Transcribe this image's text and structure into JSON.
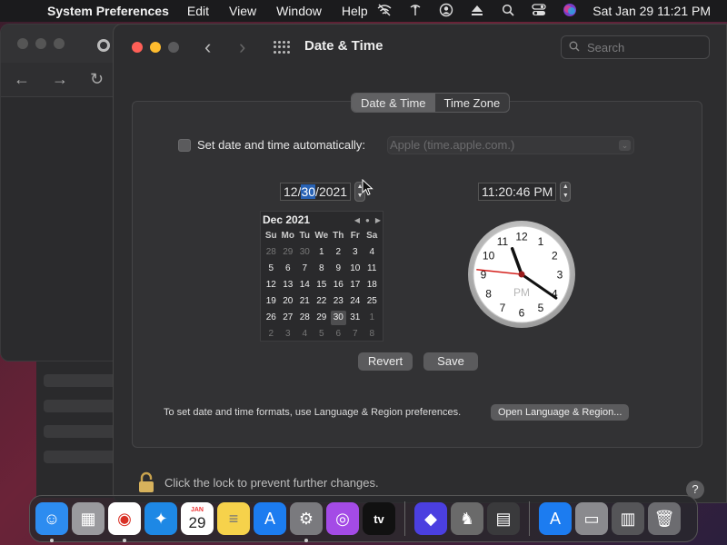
{
  "menubar": {
    "app_name": "System Preferences",
    "items": [
      "Edit",
      "View",
      "Window",
      "Help"
    ],
    "datetime": "Sat Jan 29  11:21 PM",
    "icons": [
      "wifi-off-icon",
      "network-icon",
      "user-icon",
      "eject-icon",
      "search-icon",
      "control-center-icon",
      "siri-icon"
    ]
  },
  "window": {
    "title": "Date & Time",
    "search_placeholder": "Search"
  },
  "tabs": [
    {
      "label": "Date & Time",
      "active": true
    },
    {
      "label": "Time Zone",
      "active": false
    }
  ],
  "auto": {
    "label": "Set date and time automatically:",
    "server": "Apple (time.apple.com.)",
    "checked": false
  },
  "date_field": {
    "month": "12",
    "sep1": "/",
    "day": "30",
    "sep2": "/",
    "year": "2021"
  },
  "time_field": {
    "value": "11:20:46 PM"
  },
  "calendar": {
    "month_label": "Dec 2021",
    "dow": [
      "Su",
      "Mo",
      "Tu",
      "We",
      "Th",
      "Fr",
      "Sa"
    ],
    "weeks": [
      [
        {
          "d": "28",
          "out": true
        },
        {
          "d": "29",
          "out": true
        },
        {
          "d": "30",
          "out": true
        },
        {
          "d": "1"
        },
        {
          "d": "2"
        },
        {
          "d": "3"
        },
        {
          "d": "4"
        }
      ],
      [
        {
          "d": "5"
        },
        {
          "d": "6"
        },
        {
          "d": "7"
        },
        {
          "d": "8"
        },
        {
          "d": "9"
        },
        {
          "d": "10"
        },
        {
          "d": "11"
        }
      ],
      [
        {
          "d": "12"
        },
        {
          "d": "13"
        },
        {
          "d": "14"
        },
        {
          "d": "15"
        },
        {
          "d": "16"
        },
        {
          "d": "17"
        },
        {
          "d": "18"
        }
      ],
      [
        {
          "d": "19"
        },
        {
          "d": "20"
        },
        {
          "d": "21"
        },
        {
          "d": "22"
        },
        {
          "d": "23"
        },
        {
          "d": "24"
        },
        {
          "d": "25"
        }
      ],
      [
        {
          "d": "26"
        },
        {
          "d": "27"
        },
        {
          "d": "28"
        },
        {
          "d": "29"
        },
        {
          "d": "30",
          "sel": true
        },
        {
          "d": "31"
        },
        {
          "d": "1",
          "out": true
        }
      ],
      [
        {
          "d": "2",
          "out": true
        },
        {
          "d": "3",
          "out": true
        },
        {
          "d": "4",
          "out": true
        },
        {
          "d": "5",
          "out": true
        },
        {
          "d": "6",
          "out": true
        },
        {
          "d": "7",
          "out": true
        },
        {
          "d": "8",
          "out": true
        }
      ]
    ]
  },
  "clock": {
    "numbers": [
      "12",
      "1",
      "2",
      "3",
      "4",
      "5",
      "6",
      "7",
      "8",
      "9",
      "10",
      "11"
    ],
    "meridiem": "PM",
    "hour": 11,
    "minute": 20,
    "second": 46
  },
  "buttons": {
    "revert": "Revert",
    "save": "Save",
    "open_language": "Open Language & Region..."
  },
  "formats_text": "To set date and time formats, use Language & Region preferences.",
  "lock_text": "Click the lock to prevent further changes.",
  "help": "?",
  "dock": {
    "apps": [
      {
        "name": "finder",
        "color": "#2d8cf0",
        "glyph": "☺",
        "running": true
      },
      {
        "name": "launchpad",
        "color": "#9a9a9e",
        "glyph": "▦",
        "running": false
      },
      {
        "name": "chrome",
        "color": "#ffffff",
        "glyph": "◉",
        "running": true
      },
      {
        "name": "safari",
        "color": "#1e88e5",
        "glyph": "✦",
        "running": false
      },
      {
        "name": "calendar",
        "color": "#ffffff",
        "glyph": "",
        "running": false
      },
      {
        "name": "notes",
        "color": "#f6d24b",
        "glyph": "≡",
        "running": false
      },
      {
        "name": "app-store",
        "color": "#1c7cf0",
        "glyph": "A",
        "running": false
      },
      {
        "name": "system-preferences",
        "color": "#7a7a7e",
        "glyph": "⚙",
        "running": true
      },
      {
        "name": "podcasts",
        "color": "#a44be6",
        "glyph": "◎",
        "running": false
      },
      {
        "name": "apple-tv",
        "color": "#111111",
        "glyph": "tv",
        "running": false
      },
      {
        "name": "shortcuts",
        "color": "#4b3fe0",
        "glyph": "◆",
        "running": false
      },
      {
        "name": "chess",
        "color": "#6a6a6a",
        "glyph": "♞",
        "running": false
      },
      {
        "name": "calculator",
        "color": "#3a3a3c",
        "glyph": "▤",
        "running": false
      },
      {
        "name": "app-store-downloads",
        "color": "#1c7cf0",
        "glyph": "A",
        "running": false
      },
      {
        "name": "disk-utility",
        "color": "#8a8a8e",
        "glyph": "▭",
        "running": false
      },
      {
        "name": "recent-apps",
        "color": "#555558",
        "glyph": "▥",
        "running": false
      },
      {
        "name": "trash",
        "color": "#6c6c70",
        "glyph": "🗑",
        "running": false
      }
    ],
    "calendar_month": "JAN",
    "calendar_day": "29",
    "tv_label": "tv"
  }
}
